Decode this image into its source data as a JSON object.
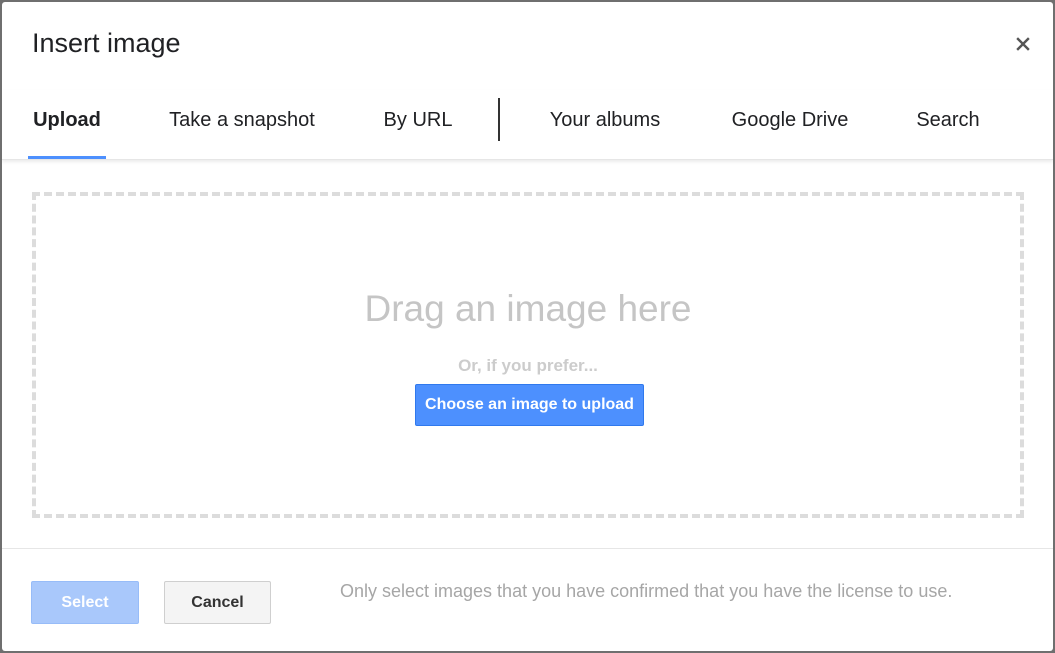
{
  "dialog": {
    "title": "Insert image",
    "close_glyph": "×",
    "close_icon": "close-icon"
  },
  "tabs": [
    {
      "label": "Upload",
      "active": true
    },
    {
      "label": "Take a snapshot",
      "active": false
    },
    {
      "label": "By URL",
      "active": false
    },
    {
      "label": "Your albums",
      "active": false
    },
    {
      "label": "Google Drive",
      "active": false
    },
    {
      "label": "Search",
      "active": false
    }
  ],
  "upload": {
    "drag_text": "Drag an image here",
    "prefer_text": "Or, if you prefer...",
    "choose_button": "Choose an image to upload"
  },
  "footer": {
    "select_label": "Select",
    "cancel_label": "Cancel",
    "license_note": "Only select images that you have confirmed that you have the license to use."
  },
  "colors": {
    "accent": "#4d90fe",
    "select_disabled": "#a9c8fb",
    "muted_text": "#c5c5c5"
  }
}
